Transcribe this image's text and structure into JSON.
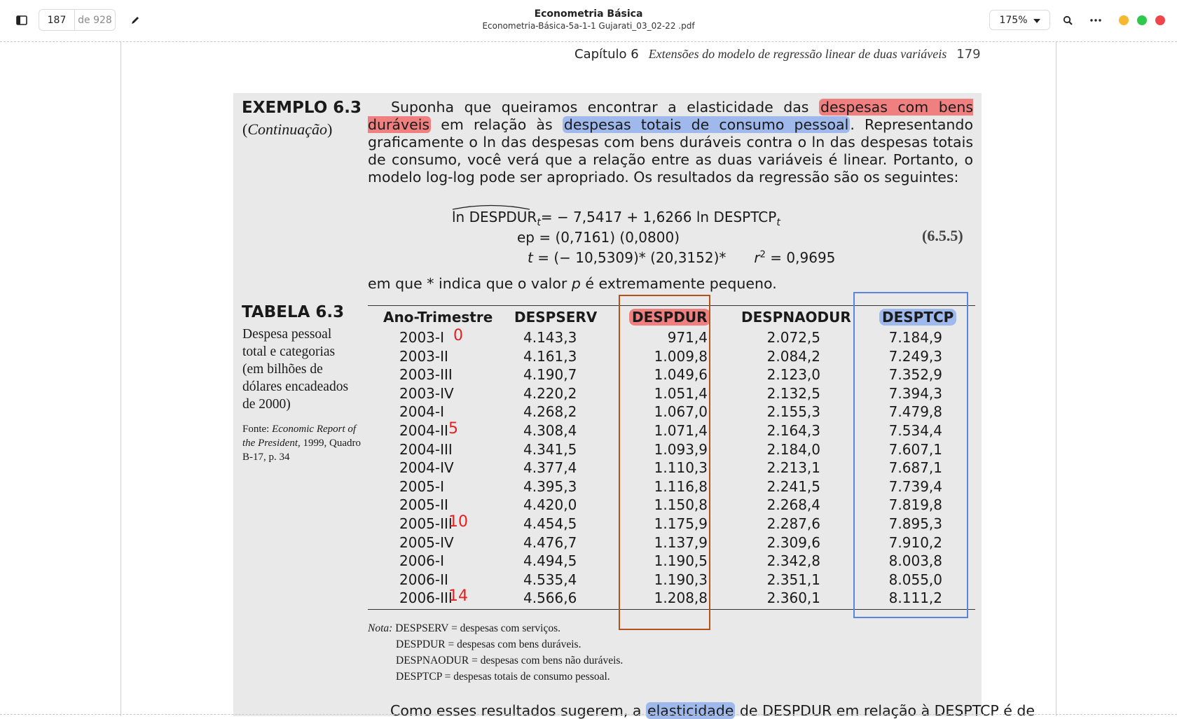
{
  "toolbar": {
    "page_current": "187",
    "page_total": "de 928",
    "doc_title": "Econometria Básica",
    "doc_filename": "Econometria-Básica-5a-1-1 Gujarati_03_02-22 .pdf",
    "zoom": "175%",
    "icons": [
      "sidebar-toggle-icon",
      "pen-icon",
      "search-icon",
      "more-icon",
      "chevron-down-icon"
    ],
    "window_colors": {
      "minimize": "#f5b82e",
      "maximize": "#2ec84a",
      "close": "#f0454a"
    }
  },
  "page": {
    "header_chapter": "Capítulo  6",
    "header_title": "Extensões do modelo de regressão linear de duas variáveis",
    "header_page": "179",
    "example_title": "EXEMPLO 6.3",
    "example_cont_open": "(",
    "example_cont": "Continuação",
    "example_cont_close": ")",
    "para": {
      "t1": "Suponha que queiramos encontrar a elasticidade das ",
      "hl1": "despesas com bens duráveis",
      "t2": " em relação às ",
      "hl2": "despesas totais de consumo pessoal",
      "t3": ". Representando graficamente o ln das despesas com bens duráveis contra o ln das despesas totais de consumo, você verá que a relação entre as duas variáveis é linear. Portanto, o modelo log-log pode ser apropriado. Os resultados da regressão são os seguintes:"
    },
    "equation": {
      "lhs": "ln DESPDUR",
      "lhs_sub": "t",
      "line1_rest": "=   − 7,5417   +    1,6266 ln DESPTCP",
      "line1_sub": "t",
      "line2": "ep =      (0,7161)      (0,0800)",
      "line3_t": "t",
      "line3": " = (− 10,5309)*    (20,3152)*",
      "r2_label": "r",
      "r2_exp": "2",
      "r2_value": " =  0,9695",
      "number": "(6.5.5)"
    },
    "em_que_1": "em que * indica que o valor ",
    "em_que_p": "p",
    "em_que_2": " é extremamente pequeno.",
    "table_title": "TABELA 6.3",
    "table_desc": "Despesa pessoal total e categorias (em bilhões de dólares encadeados de 2000)",
    "table_src_label": "Fonte: ",
    "table_src_italic": "Economic Report of the President,",
    "table_src_rest": " 1999, Quadro B-17, p. 34",
    "columns": [
      "Ano-Trimestre",
      "DESPSERV",
      "DESPDUR",
      "DESPNAODUR",
      "DESPTCP"
    ],
    "rows": [
      [
        "2003-I",
        "4.143,3",
        "971,4",
        "2.072,5",
        "7.184,9"
      ],
      [
        "2003-II",
        "4.161,3",
        "1.009,8",
        "2.084,2",
        "7.249,3"
      ],
      [
        "2003-III",
        "4.190,7",
        "1.049,6",
        "2.123,0",
        "7.352,9"
      ],
      [
        "2003-IV",
        "4.220,2",
        "1.051,4",
        "2.132,5",
        "7.394,3"
      ],
      [
        "2004-I",
        "4.268,2",
        "1.067,0",
        "2.155,3",
        "7.479,8"
      ],
      [
        "2004-II",
        "4.308,4",
        "1.071,4",
        "2.164,3",
        "7.534,4"
      ],
      [
        "2004-III",
        "4.341,5",
        "1.093,9",
        "2.184,0",
        "7.607,1"
      ],
      [
        "2004-IV",
        "4.377,4",
        "1.110,3",
        "2.213,1",
        "7.687,1"
      ],
      [
        "2005-I",
        "4.395,3",
        "1.116,8",
        "2.241,5",
        "7.739,4"
      ],
      [
        "2005-II",
        "4.420,0",
        "1.150,8",
        "2.268,4",
        "7.819,8"
      ],
      [
        "2005-III",
        "4.454,5",
        "1.175,9",
        "2.287,6",
        "7.895,3"
      ],
      [
        "2005-IV",
        "4.476,7",
        "1.137,9",
        "2.309,6",
        "7.910,2"
      ],
      [
        "2006-I",
        "4.494,5",
        "1.190,5",
        "2.342,8",
        "8.003,8"
      ],
      [
        "2006-II",
        "4.535,4",
        "1.190,3",
        "2.351,1",
        "8.055,0"
      ],
      [
        "2006-III",
        "4.566,6",
        "1.208,8",
        "2.360,1",
        "8.111,2"
      ]
    ],
    "handwritten_marks": {
      "0": "0",
      "5": "5",
      "10": "10",
      "14": "14"
    },
    "notes": {
      "label": "Nota:",
      "l1": " DESPSERV = despesas com serviços.",
      "l2": "DESPDUR = despesas com bens duráveis.",
      "l3": "DESPNAODUR = despesas com bens não duráveis.",
      "l4": "DESPTCP = despesas totais de consumo pessoal."
    },
    "last_line_1": "Como esses resultados sugerem, a ",
    "last_line_hl": "elasticidade",
    "last_line_2": " de DESPDUR em relação à DESPTCP é de",
    "colors": {
      "highlight_red": "#f08080",
      "highlight_blue": "#9fb9ec",
      "box_orange": "#b5521a",
      "box_blue": "#5b83e0",
      "ink_red": "#e32020"
    }
  }
}
